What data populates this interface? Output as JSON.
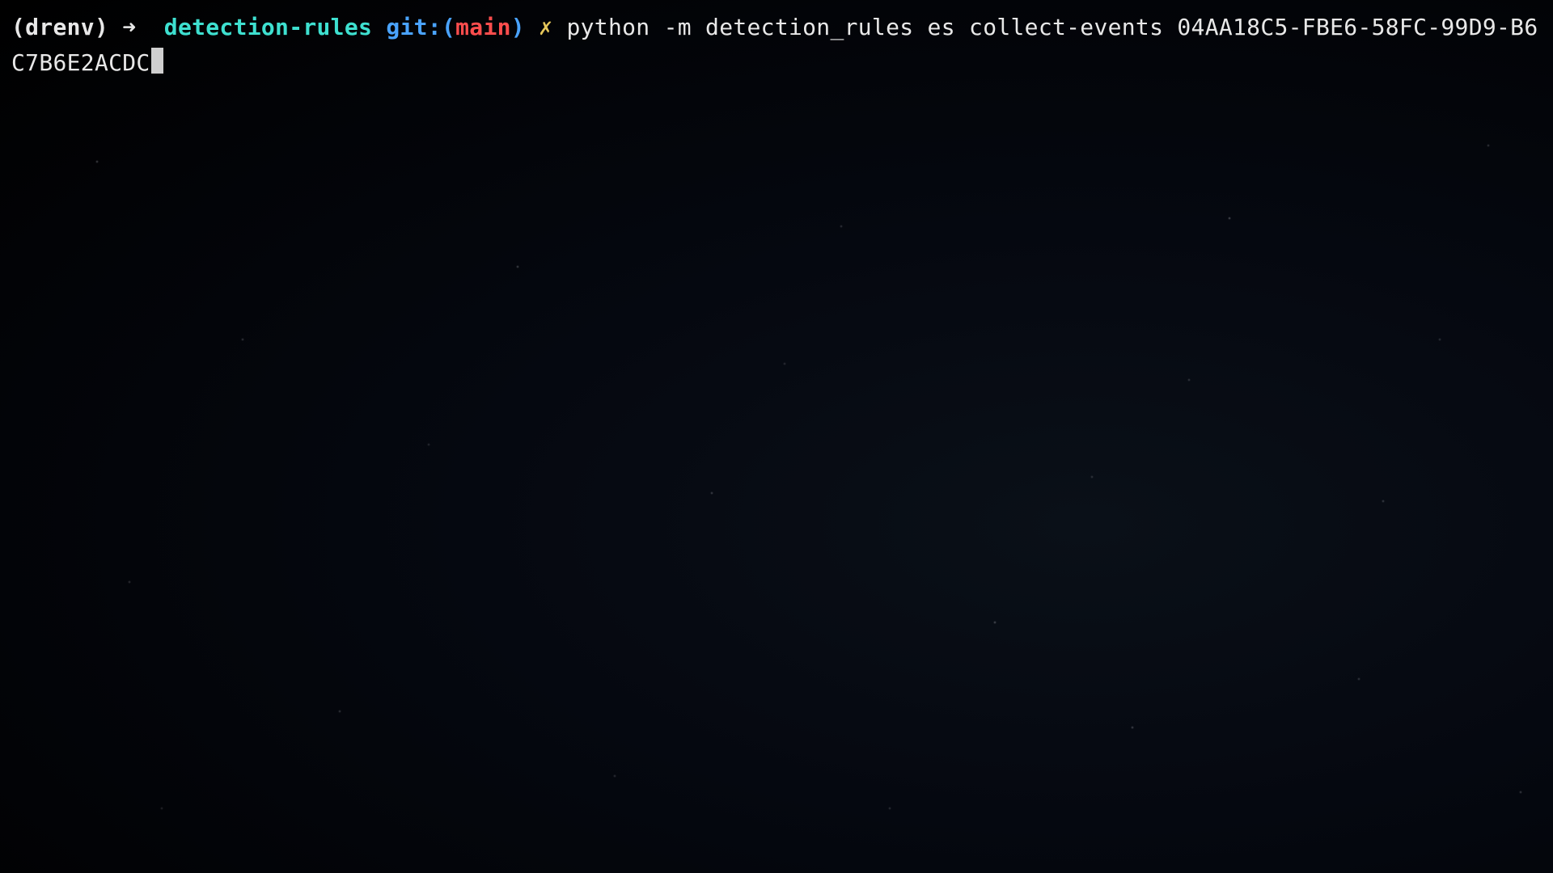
{
  "prompt": {
    "env": "(drenv)",
    "arrow": "➜",
    "directory": "detection-rules",
    "git_label": "git:",
    "git_paren_open": "(",
    "branch": "main",
    "git_paren_close": ")",
    "dirty_marker": "✗",
    "command": "python -m detection_rules es collect-events 04AA18C5-FBE6-58FC-99D9-B6C7B6E2ACDC"
  },
  "colors": {
    "env": "#e8e8e8",
    "arrow": "#e8e8e8",
    "directory": "#3ee0d0",
    "git_label": "#4aa3ff",
    "branch": "#ff4d4d",
    "dirty_marker": "#e6c75a",
    "command": "#e8e8e8",
    "cursor": "#cfcfcf",
    "background": "#000000"
  }
}
